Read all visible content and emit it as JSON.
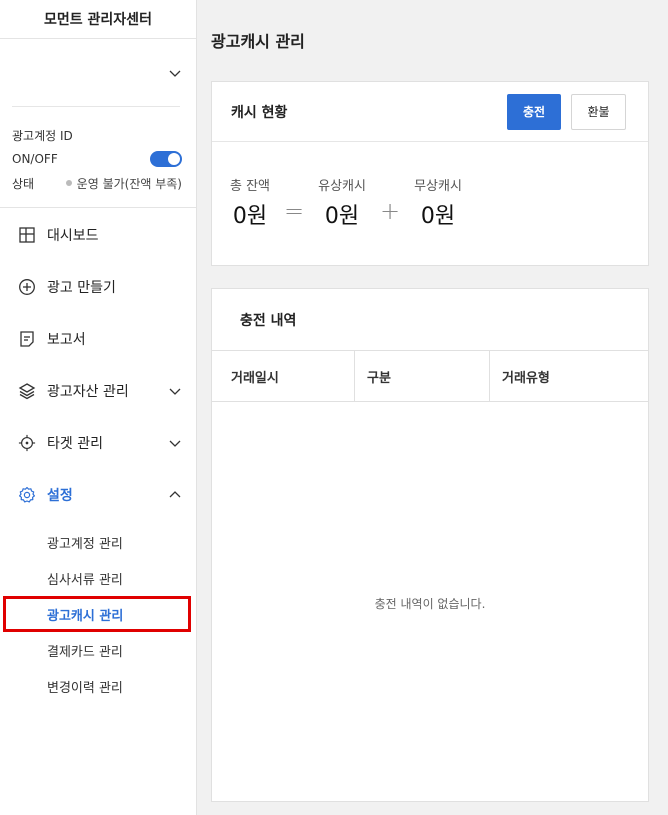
{
  "sidebar": {
    "brand": "모먼트 관리자센터",
    "account": {
      "id_label": "광고계정 ID",
      "onoff_label": "ON/OFF",
      "status_label": "상태",
      "status_value": "운영 불가(잔액 부족)"
    },
    "nav": [
      {
        "label": "대시보드",
        "icon": "dashboard-icon"
      },
      {
        "label": "광고 만들기",
        "icon": "plus-circle-icon"
      },
      {
        "label": "보고서",
        "icon": "report-icon"
      },
      {
        "label": "광고자산 관리",
        "icon": "layers-icon"
      },
      {
        "label": "타겟 관리",
        "icon": "target-icon"
      },
      {
        "label": "설정",
        "icon": "gear-icon"
      }
    ],
    "settings_sub": [
      "광고계정 관리",
      "심사서류 관리",
      "광고캐시 관리",
      "결제카드 관리",
      "변경이력 관리"
    ]
  },
  "main": {
    "title": "광고캐시 관리",
    "cash": {
      "title": "캐시 현황",
      "charge_button": "충전",
      "refund_button": "환불",
      "total_label": "총 잔액",
      "total_value": "0원",
      "paid_label": "유상캐시",
      "paid_value": "0원",
      "free_label": "무상캐시",
      "free_value": "0원",
      "op_equals": "=",
      "op_plus": "+"
    },
    "history": {
      "title": "충전 내역",
      "columns": [
        "거래일시",
        "구분",
        "거래유형"
      ],
      "empty_text": "충전 내역이 없습니다."
    }
  },
  "colors": {
    "accent": "#2d6fd6",
    "highlight_border": "#e00000"
  }
}
